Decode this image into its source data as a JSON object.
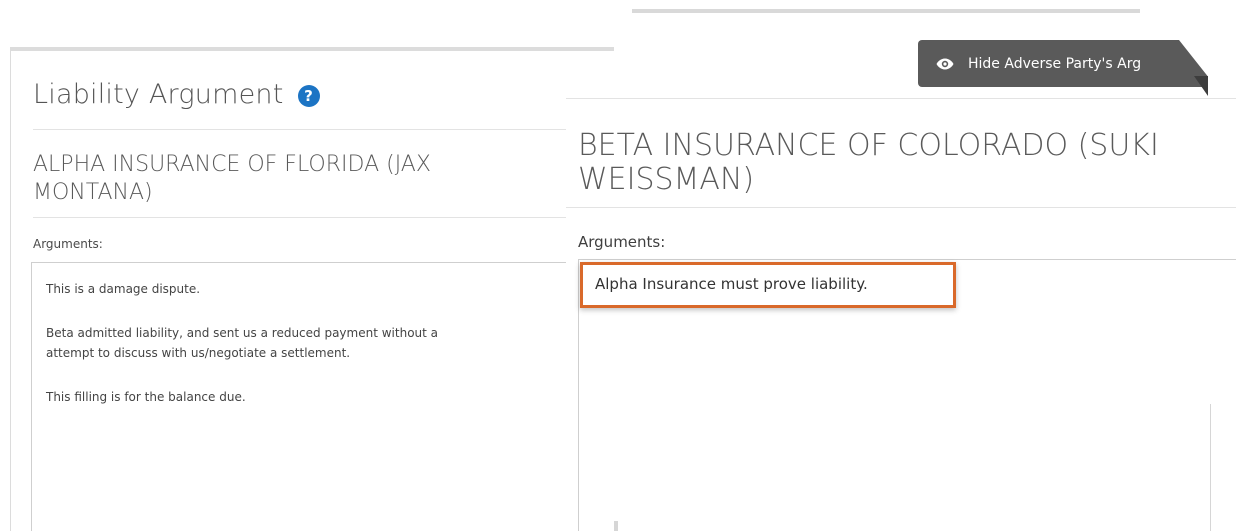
{
  "left": {
    "title": "Liability Argument",
    "help_icon": "question-circle-icon",
    "party": "ALPHA INSURANCE OF FLORIDA (JAX MONTANA)",
    "arguments_label": "Arguments:",
    "arguments": [
      "This is a damage dispute.",
      "Beta admitted liability, and sent us a reduced payment without a",
      "attempt to discuss with us/negotiate a settlement.",
      "This filling is for the balance due."
    ]
  },
  "right": {
    "hide_button_label": "Hide Adverse Party's Arg",
    "hide_button_icon": "eye-icon",
    "party": "BETA INSURANCE OF COLORADO (SUKI WEISSMAN)",
    "arguments_label": "Arguments:",
    "argument_text": "Alpha Insurance must prove liability."
  },
  "colors": {
    "help_icon": "#1c74c4",
    "highlight_border": "#d9692a",
    "button_bg": "#5a5a5a"
  }
}
